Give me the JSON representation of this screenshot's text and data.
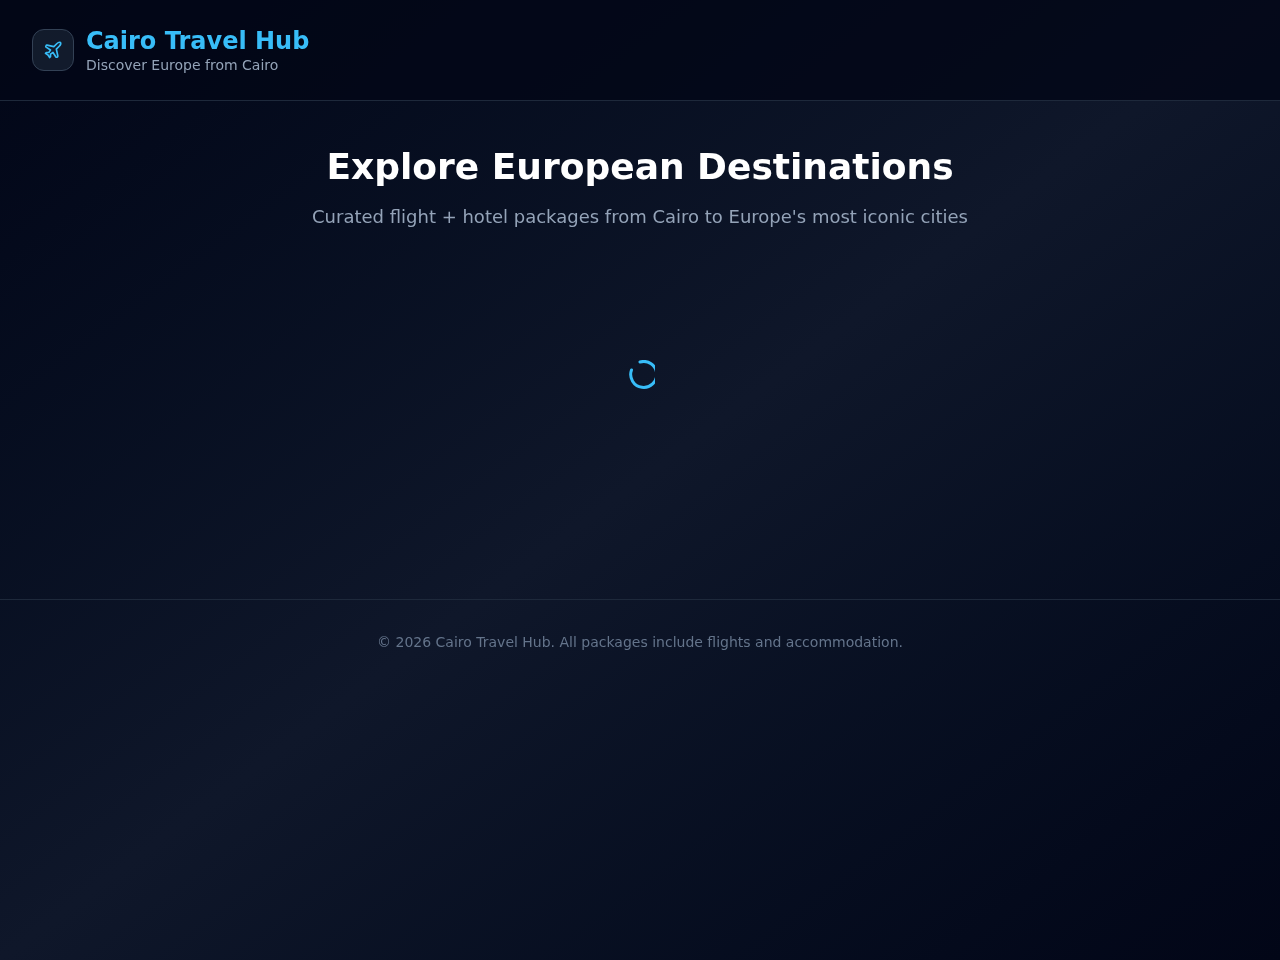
{
  "header": {
    "title": "Cairo Travel Hub",
    "subtitle": "Discover Europe from Cairo"
  },
  "hero": {
    "heading": "Explore European Destinations",
    "subheading": "Curated flight + hotel packages from Cairo to Europe's most iconic cities"
  },
  "content": {
    "loading": true
  },
  "footer": {
    "text": "© 2026 Cairo Travel Hub. All packages include flights and accommodation."
  }
}
